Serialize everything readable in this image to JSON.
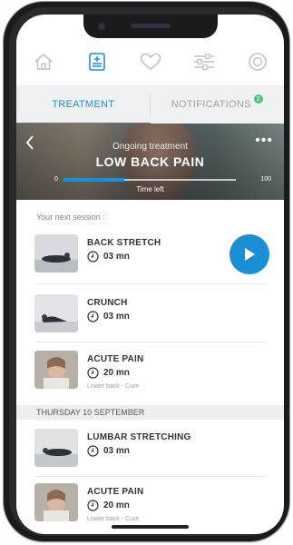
{
  "nav": {
    "icons": [
      "home-icon",
      "treatment-icon",
      "heart-icon",
      "sliders-icon",
      "settings-icon"
    ],
    "active_index": 1
  },
  "tabs": {
    "treatment": "TREATMENT",
    "notifications": "NOTIFICATIONS",
    "notifications_badge": "2"
  },
  "hero": {
    "subtitle": "Ongoing treatment",
    "title": "LOW BACK PAIN",
    "progress_min": "0",
    "progress_max": "100",
    "progress_label": "Time left",
    "progress_value": 35,
    "more": "•••"
  },
  "next_session_label": "Your next session :",
  "sessions": [
    {
      "name": "BACK STRETCH",
      "duration": "03 mn",
      "note": ""
    },
    {
      "name": "CRUNCH",
      "duration": "03 mn",
      "note": ""
    },
    {
      "name": "ACUTE PAIN",
      "duration": "20 mn",
      "note": "Lower back - Cure"
    }
  ],
  "date_header": "THURSDAY 10 SEPTEMBER",
  "later_sessions": [
    {
      "name": "LUMBAR STRETCHING",
      "duration": "03 mn",
      "note": ""
    },
    {
      "name": "ACUTE PAIN",
      "duration": "20 mn",
      "note": "Lower back - Cure"
    }
  ],
  "colors": {
    "accent": "#1b8fd6",
    "badge": "#53c27a"
  }
}
